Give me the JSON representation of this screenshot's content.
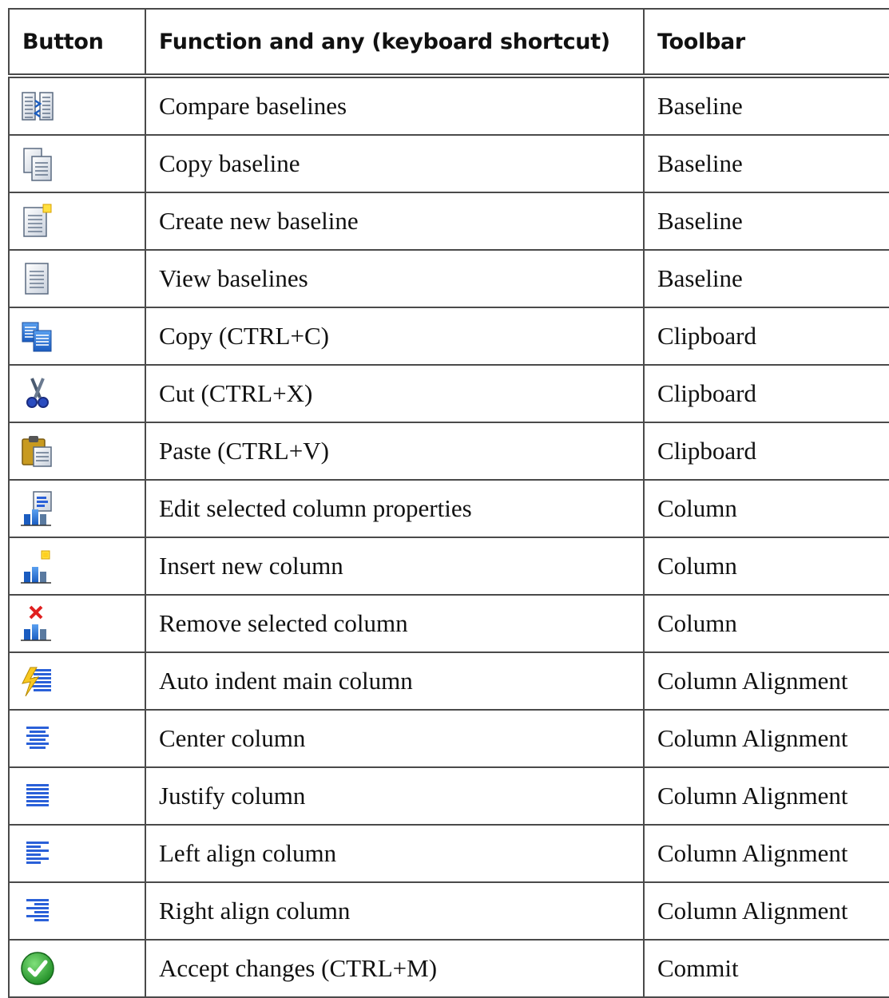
{
  "header": {
    "button": "Button",
    "function": "Function and any (keyboard shortcut)",
    "toolbar": "Toolbar"
  },
  "rows": [
    {
      "icon": "compare-baselines-icon",
      "function": "Compare baselines",
      "toolbar": "Baseline"
    },
    {
      "icon": "copy-baseline-icon",
      "function": "Copy baseline",
      "toolbar": "Baseline"
    },
    {
      "icon": "create-new-baseline-icon",
      "function": "Create new baseline",
      "toolbar": "Baseline"
    },
    {
      "icon": "view-baselines-icon",
      "function": "View baselines",
      "toolbar": "Baseline"
    },
    {
      "icon": "copy-icon",
      "function": "Copy (CTRL+C)",
      "toolbar": "Clipboard"
    },
    {
      "icon": "cut-scissors-icon",
      "function": "Cut (CTRL+X)",
      "toolbar": "Clipboard"
    },
    {
      "icon": "paste-clipboard-icon",
      "function": "Paste (CTRL+V)",
      "toolbar": "Clipboard"
    },
    {
      "icon": "column-properties-icon",
      "function": "Edit selected column properties",
      "toolbar": "Column"
    },
    {
      "icon": "insert-column-icon",
      "function": "Insert new column",
      "toolbar": "Column"
    },
    {
      "icon": "remove-column-icon",
      "function": "Remove selected column",
      "toolbar": "Column"
    },
    {
      "icon": "auto-indent-icon",
      "function": "Auto indent main column",
      "toolbar": "Column Alignment"
    },
    {
      "icon": "align-center-icon",
      "function": "Center column",
      "toolbar": "Column Alignment"
    },
    {
      "icon": "align-justify-icon",
      "function": "Justify column",
      "toolbar": "Column Alignment"
    },
    {
      "icon": "align-left-icon",
      "function": "Left align column",
      "toolbar": "Column Alignment"
    },
    {
      "icon": "align-right-icon",
      "function": "Right align column",
      "toolbar": "Column Alignment"
    },
    {
      "icon": "accept-check-icon",
      "function": "Accept changes (CTRL+M)",
      "toolbar": "Commit"
    }
  ]
}
